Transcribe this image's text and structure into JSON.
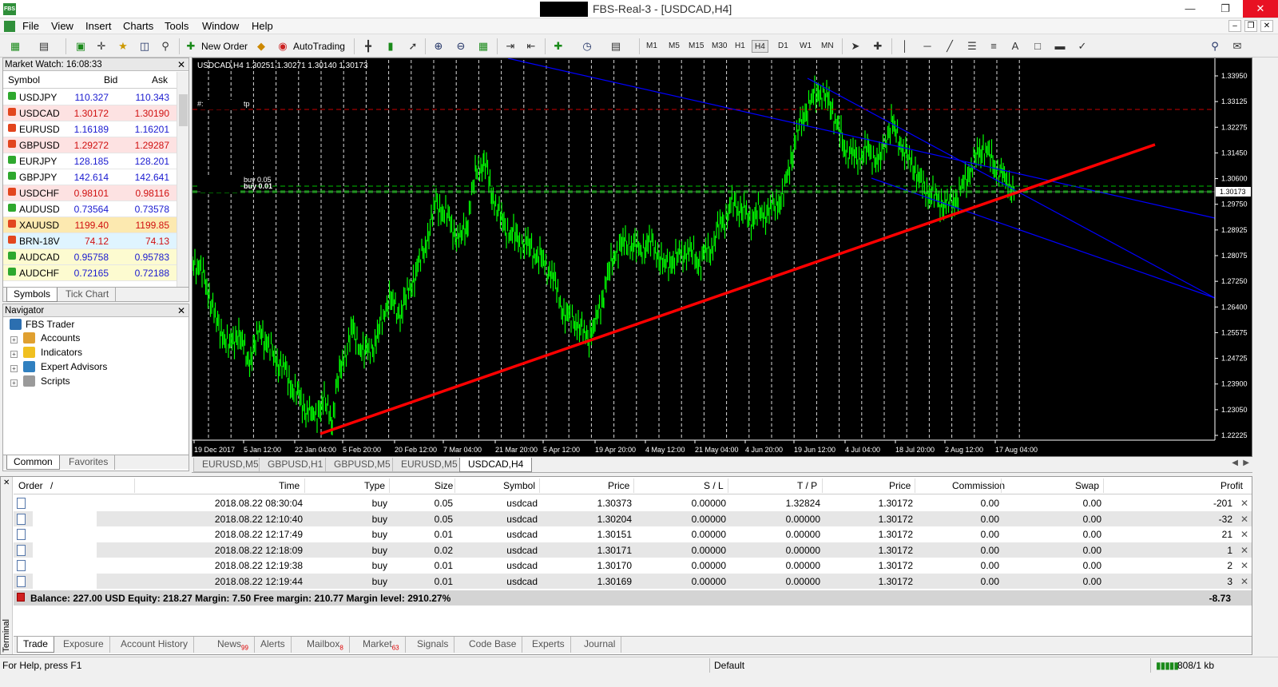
{
  "window": {
    "title": "FBS-Real-3 - [USDCAD,H4]",
    "app_icon_text": "FBS"
  },
  "menu": [
    "File",
    "View",
    "Insert",
    "Charts",
    "Tools",
    "Window",
    "Help"
  ],
  "toolbar": {
    "new_order": "New Order",
    "autotrading": "AutoTrading",
    "timeframes": [
      "M1",
      "M5",
      "M15",
      "M30",
      "H1",
      "H4",
      "D1",
      "W1",
      "MN"
    ],
    "active_timeframe": "H4"
  },
  "market_watch": {
    "title": "Market Watch: 16:08:33",
    "headers": {
      "symbol": "Symbol",
      "bid": "Bid",
      "ask": "Ask"
    },
    "rows": [
      {
        "symbol": "USDJPY",
        "bid": "110.327",
        "ask": "110.343",
        "dir": "up",
        "bg": "#ffffff",
        "color": "#1a1ad0"
      },
      {
        "symbol": "USDCAD",
        "bid": "1.30172",
        "ask": "1.30190",
        "dir": "down",
        "bg": "#fde2e2",
        "color": "#d01010"
      },
      {
        "symbol": "EURUSD",
        "bid": "1.16189",
        "ask": "1.16201",
        "dir": "down",
        "bg": "#ffffff",
        "color": "#1a1ad0"
      },
      {
        "symbol": "GBPUSD",
        "bid": "1.29272",
        "ask": "1.29287",
        "dir": "down",
        "bg": "#fde2e2",
        "color": "#d01010"
      },
      {
        "symbol": "EURJPY",
        "bid": "128.185",
        "ask": "128.201",
        "dir": "up",
        "bg": "#ffffff",
        "color": "#1a1ad0"
      },
      {
        "symbol": "GBPJPY",
        "bid": "142.614",
        "ask": "142.641",
        "dir": "up",
        "bg": "#ffffff",
        "color": "#1a1ad0"
      },
      {
        "symbol": "USDCHF",
        "bid": "0.98101",
        "ask": "0.98116",
        "dir": "down",
        "bg": "#fde2e2",
        "color": "#d01010"
      },
      {
        "symbol": "AUDUSD",
        "bid": "0.73564",
        "ask": "0.73578",
        "dir": "up",
        "bg": "#ffffff",
        "color": "#1a1ad0"
      },
      {
        "symbol": "XAUUSD",
        "bid": "1199.40",
        "ask": "1199.85",
        "dir": "down",
        "bg": "#fce9b0",
        "color": "#d01010"
      },
      {
        "symbol": "BRN-18V",
        "bid": "74.12",
        "ask": "74.13",
        "dir": "down",
        "bg": "#dff4ff",
        "color": "#d01010"
      },
      {
        "symbol": "AUDCAD",
        "bid": "0.95758",
        "ask": "0.95783",
        "dir": "up",
        "bg": "#fdfbd0",
        "color": "#1a1ad0"
      },
      {
        "symbol": "AUDCHF",
        "bid": "0.72165",
        "ask": "0.72188",
        "dir": "up",
        "bg": "#fdfbd0",
        "color": "#1a1ad0"
      }
    ],
    "tabs": [
      "Symbols",
      "Tick Chart"
    ]
  },
  "navigator": {
    "title": "Navigator",
    "root": "FBS Trader",
    "items": [
      "Accounts",
      "Indicators",
      "Expert Advisors",
      "Scripts"
    ],
    "tabs": [
      "Common",
      "Favorites"
    ]
  },
  "chart": {
    "header": "USDCAD,H4  1.30251 1.30271 1.30140 1.30173",
    "current_price": "1.30173",
    "order_label_1": "buy 0.05",
    "order_label_2": "buy 0.01",
    "tp_label": "tp",
    "y_ticks": [
      "1.33950",
      "1.33125",
      "1.32275",
      "1.31450",
      "1.30600",
      "1.29750",
      "1.28925",
      "1.28075",
      "1.27250",
      "1.26400",
      "1.25575",
      "1.24725",
      "1.23900",
      "1.23050",
      "1.22225"
    ],
    "x_ticks": [
      "19 Dec 2017",
      "5 Jan 12:00",
      "22 Jan 04:00",
      "5 Feb 20:00",
      "20 Feb 12:00",
      "7 Mar 04:00",
      "21 Mar 20:00",
      "5 Apr 12:00",
      "19 Apr 20:00",
      "4 May 12:00",
      "21 May 04:00",
      "4 Jun 20:00",
      "19 Jun 12:00",
      "4 Jul 04:00",
      "18 Jul 20:00",
      "2 Aug 12:00",
      "17 Aug 04:00"
    ],
    "colors": {
      "bars": "#00ff00",
      "trend": "#ff0000",
      "channel": "#0000ff",
      "tp": "#c80000",
      "grid": "#ffffff"
    },
    "tabs": [
      "EURUSD,M5",
      "GBPUSD,H1",
      "GBPUSD,M5",
      "EURUSD,M5",
      "USDCAD,H4"
    ],
    "active_tab": "USDCAD,H4"
  },
  "terminal": {
    "side_label": "Terminal",
    "headers": [
      "Order",
      "/",
      "Time",
      "Type",
      "Size",
      "Symbol",
      "Price",
      "S / L",
      "T / P",
      "Price",
      "Commission",
      "Swap",
      "Profit"
    ],
    "orders": [
      {
        "time": "2018.08.22 08:30:04",
        "type": "buy",
        "size": "0.05",
        "symbol": "usdcad",
        "price": "1.30373",
        "sl": "0.00000",
        "tp": "1.32824",
        "cur": "1.30172",
        "commission": "0.00",
        "swap": "0.00",
        "profit": "-201"
      },
      {
        "time": "2018.08.22 12:10:40",
        "type": "buy",
        "size": "0.05",
        "symbol": "usdcad",
        "price": "1.30204",
        "sl": "0.00000",
        "tp": "0.00000",
        "cur": "1.30172",
        "commission": "0.00",
        "swap": "0.00",
        "profit": "-32"
      },
      {
        "time": "2018.08.22 12:17:49",
        "type": "buy",
        "size": "0.01",
        "symbol": "usdcad",
        "price": "1.30151",
        "sl": "0.00000",
        "tp": "0.00000",
        "cur": "1.30172",
        "commission": "0.00",
        "swap": "0.00",
        "profit": "21"
      },
      {
        "time": "2018.08.22 12:18:09",
        "type": "buy",
        "size": "0.02",
        "symbol": "usdcad",
        "price": "1.30171",
        "sl": "0.00000",
        "tp": "0.00000",
        "cur": "1.30172",
        "commission": "0.00",
        "swap": "0.00",
        "profit": "1"
      },
      {
        "time": "2018.08.22 12:19:38",
        "type": "buy",
        "size": "0.01",
        "symbol": "usdcad",
        "price": "1.30170",
        "sl": "0.00000",
        "tp": "0.00000",
        "cur": "1.30172",
        "commission": "0.00",
        "swap": "0.00",
        "profit": "2"
      },
      {
        "time": "2018.08.22 12:19:44",
        "type": "buy",
        "size": "0.01",
        "symbol": "usdcad",
        "price": "1.30169",
        "sl": "0.00000",
        "tp": "0.00000",
        "cur": "1.30172",
        "commission": "0.00",
        "swap": "0.00",
        "profit": "3"
      }
    ],
    "balance_line": "Balance: 227.00 USD  Equity: 218.27  Margin: 7.50  Free margin: 210.77  Margin level: 2910.27%",
    "total_profit": "-8.73",
    "tabs": [
      {
        "label": "Trade",
        "badge": ""
      },
      {
        "label": "Exposure",
        "badge": ""
      },
      {
        "label": "Account History",
        "badge": ""
      },
      {
        "label": "News",
        "badge": "99"
      },
      {
        "label": "Alerts",
        "badge": ""
      },
      {
        "label": "Mailbox",
        "badge": "8"
      },
      {
        "label": "Market",
        "badge": "63"
      },
      {
        "label": "Signals",
        "badge": ""
      },
      {
        "label": "Code Base",
        "badge": ""
      },
      {
        "label": "Experts",
        "badge": ""
      },
      {
        "label": "Journal",
        "badge": ""
      }
    ]
  },
  "status": {
    "help": "For Help, press F1",
    "profile": "Default",
    "traffic": "808/1 kb"
  }
}
